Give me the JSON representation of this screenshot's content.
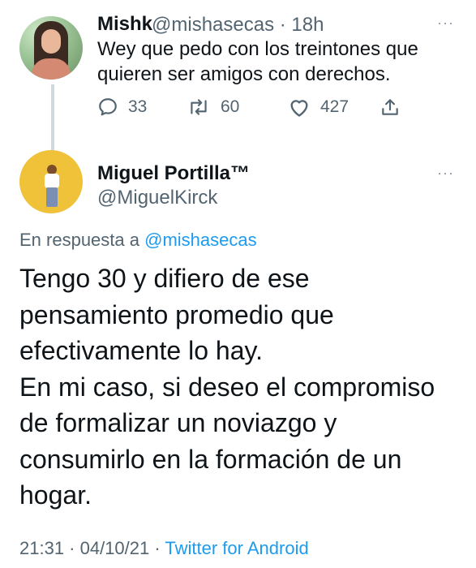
{
  "parent_tweet": {
    "display_name": "Mishk",
    "handle_time": "@mishasecas · 18h",
    "text": "Wey que pedo con los treintones que quieren ser amigos con derechos.",
    "reply_count": "33",
    "retweet_count": "60",
    "like_count": "427"
  },
  "main_tweet": {
    "display_name": "Miguel Portilla™",
    "handle": "@MiguelKirck",
    "reply_prefix": "En respuesta a ",
    "reply_mention": "@mishasecas",
    "text_lines": [
      "Tengo 30 y difiero de ese",
      "pensamiento promedio que",
      "efectivamente lo hay.",
      "En mi caso, si deseo el compromiso",
      "de formalizar un noviazgo y",
      "consumirlo en la formación de un",
      "hogar."
    ],
    "time_date": "21:31 · 04/10/21 · ",
    "source": "Twitter for Android"
  },
  "more_label": "···",
  "colors": {
    "accent": "#1d9bf0",
    "secondary_text": "#536471",
    "primary_text": "#0f1419"
  },
  "icons": {
    "reply": "reply-icon",
    "retweet": "retweet-icon",
    "like": "heart-icon",
    "share": "share-icon",
    "more": "more-icon"
  }
}
